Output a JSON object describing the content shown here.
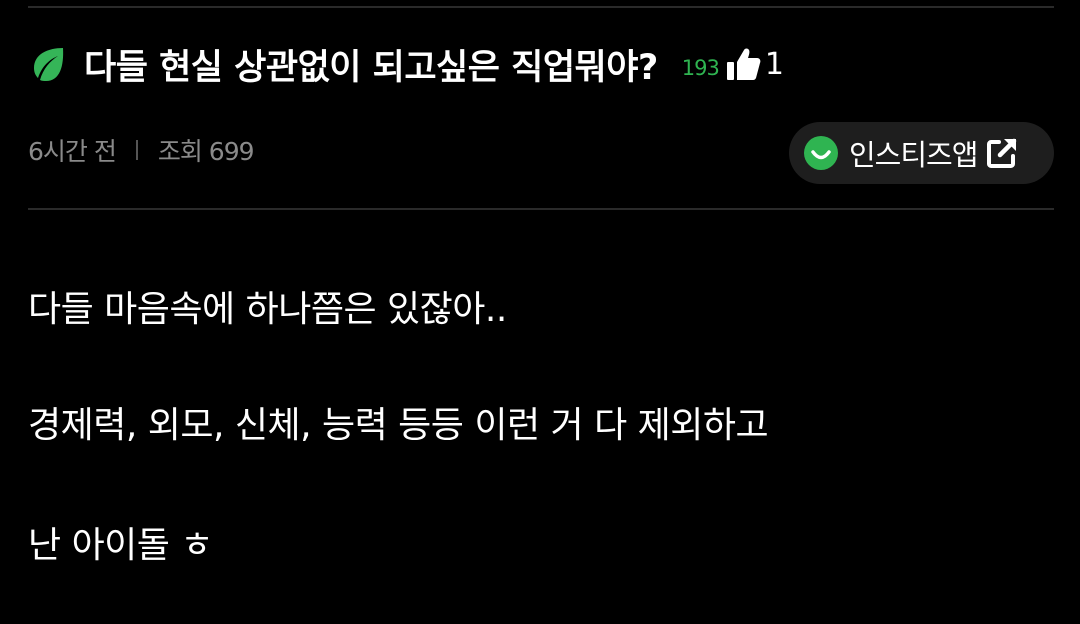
{
  "post": {
    "title": "다들 현실 상관없이 되고싶은 직업뭐야?",
    "like_count": "193",
    "comment_count": "1",
    "time_ago": "6시간 전",
    "views_label": "조회 699"
  },
  "app_button": {
    "label": "인스티즈앱"
  },
  "body": {
    "lines": [
      "다들 마음속에 하나쯤은 있잖아..",
      "경제력, 외모, 신체, 능력 등등 이런 거 다 제외하고",
      "난 아이돌 ㅎ"
    ]
  },
  "colors": {
    "background": "#000000",
    "accent_green": "#2fb451",
    "meta_gray": "#8a8a8a",
    "button_bg": "#1e1e1e"
  },
  "icons": {
    "title_icon": "leaf-icon",
    "like_icon": "thumbs-up-icon",
    "app_icon": "smile-icon",
    "open_icon": "external-link-icon"
  }
}
